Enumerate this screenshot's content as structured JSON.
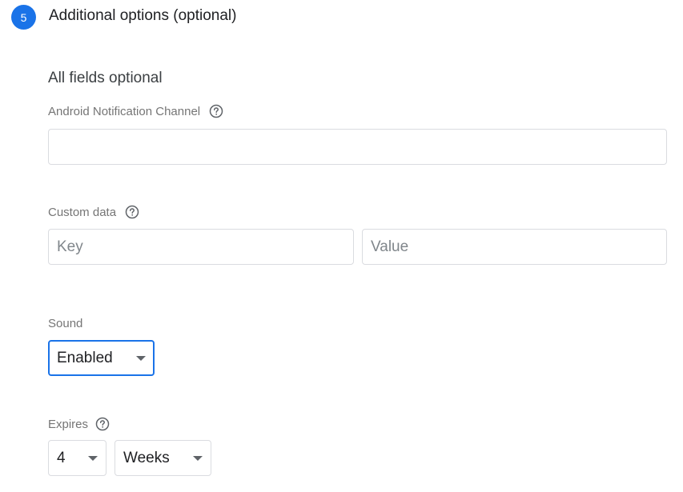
{
  "step": {
    "number": "5",
    "title": "Additional options (optional)"
  },
  "section": {
    "heading": "All fields optional"
  },
  "android_channel": {
    "label": "Android Notification Channel",
    "value": "",
    "help_icon": "help-circle-icon"
  },
  "custom_data": {
    "label": "Custom data",
    "help_icon": "help-circle-icon",
    "key_placeholder": "Key",
    "value_placeholder": "Value"
  },
  "sound": {
    "label": "Sound",
    "selected": "Enabled"
  },
  "expires": {
    "label": "Expires",
    "help_icon": "help-circle-icon",
    "amount": "4",
    "unit": "Weeks"
  },
  "colors": {
    "accent": "#1a73e8",
    "border": "#dadce0",
    "label": "#757575"
  }
}
